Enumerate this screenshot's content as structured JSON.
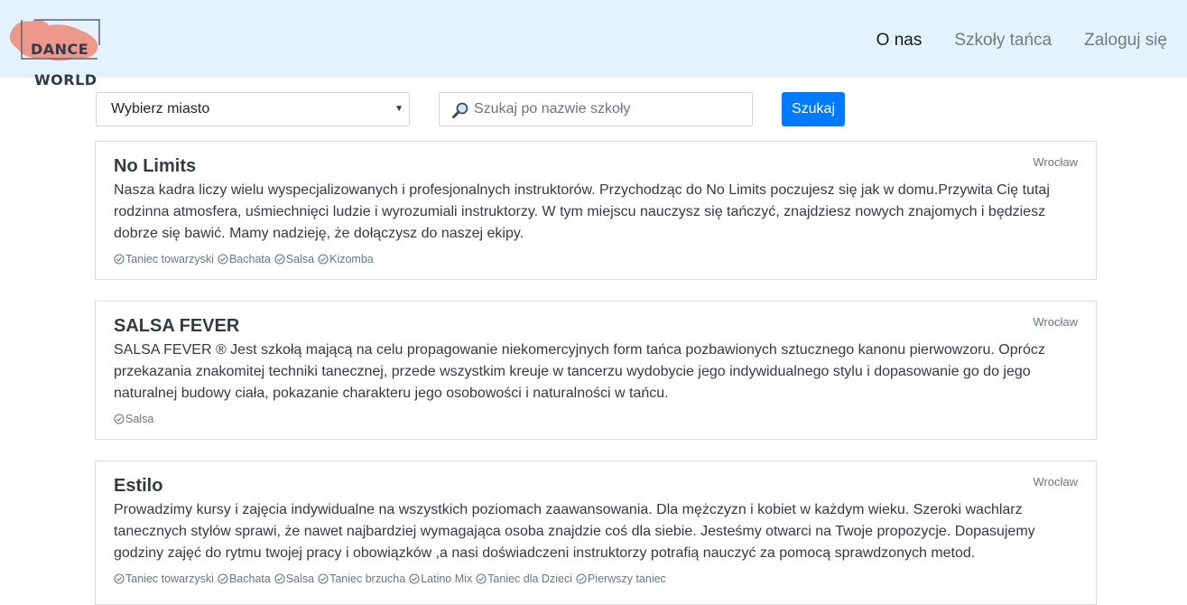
{
  "navbar": {
    "brand": {
      "line1": "DANCE",
      "line2": "WORLD"
    },
    "links": [
      {
        "label": "O nas",
        "active": true
      },
      {
        "label": "Szkoły tańca",
        "active": false
      },
      {
        "label": "Zaloguj się",
        "active": false
      }
    ]
  },
  "search": {
    "city_select_value": "Wybierz miasto",
    "name_placeholder": "Szukaj po nazwie szkoły",
    "button_label": "Szukaj"
  },
  "schools": [
    {
      "name": "No Limits",
      "city": "Wrocław",
      "description": "Nasza kadra liczy wielu wyspecjalizowanych i profesjonalnych instruktorów. Przychodząc do No Limits poczujesz się jak w domu.Przywita Cię tutaj rodzinna atmosfera, uśmiechnięci ludzie i wyrozumiali instruktorzy. W tym miejscu nauczysz się tańczyć, znajdziesz nowych znajomych i będziesz dobrze się bawić. Mamy nadzieję, że dołączysz do naszej ekipy.",
      "tags": [
        "Taniec towarzyski",
        "Bachata",
        "Salsa",
        "Kizomba"
      ]
    },
    {
      "name": "SALSA FEVER",
      "city": "Wrocław",
      "description": "SALSA FEVER ® Jest szkołą mającą na celu propagowanie niekomercyjnych form tańca pozbawionych sztucznego kanonu pierwowzoru. Oprócz przekazania znakomitej techniki tanecznej, przede wszystkim kreuje w tancerzu wydobycie jego indywidualnego stylu i dopasowanie go do jego naturalnej budowy ciała, pokazanie charakteru jego osobowości i naturalności w tańcu.",
      "tags": [
        "Salsa"
      ]
    },
    {
      "name": "Estilo",
      "city": "Wrocław",
      "description": "Prowadzimy kursy i zajęcia indywidualne na wszystkich poziomach zaawansowania. Dla mężczyzn i kobiet w każdym wieku. Szeroki wachlarz tanecznych stylów sprawi, że nawet najbardziej wymagająca osoba znajdzie coś dla siebie. Jesteśmy otwarci na Twoje propozycje. Dopasujemy godziny zajęć do rytmu twojej pracy i obowiązków ,a nasi doświadczeni instruktorzy potrafią nauczyć za pomocą sprawdzonych metod.",
      "tags": [
        "Taniec towarzyski",
        "Bachata",
        "Salsa",
        "Taniec brzucha",
        "Latino Mix",
        "Taniec dla Dzieci",
        "Pierwszy taniec"
      ]
    }
  ],
  "icons": {
    "logo": "dance-world-logo",
    "search": "magnifier-icon",
    "tag": "check-circle-icon",
    "select": "caret-down-icon"
  },
  "colors": {
    "navbar_bg": "#e3f2fd",
    "primary": "#007bff",
    "logo_splash": "#f08878"
  }
}
